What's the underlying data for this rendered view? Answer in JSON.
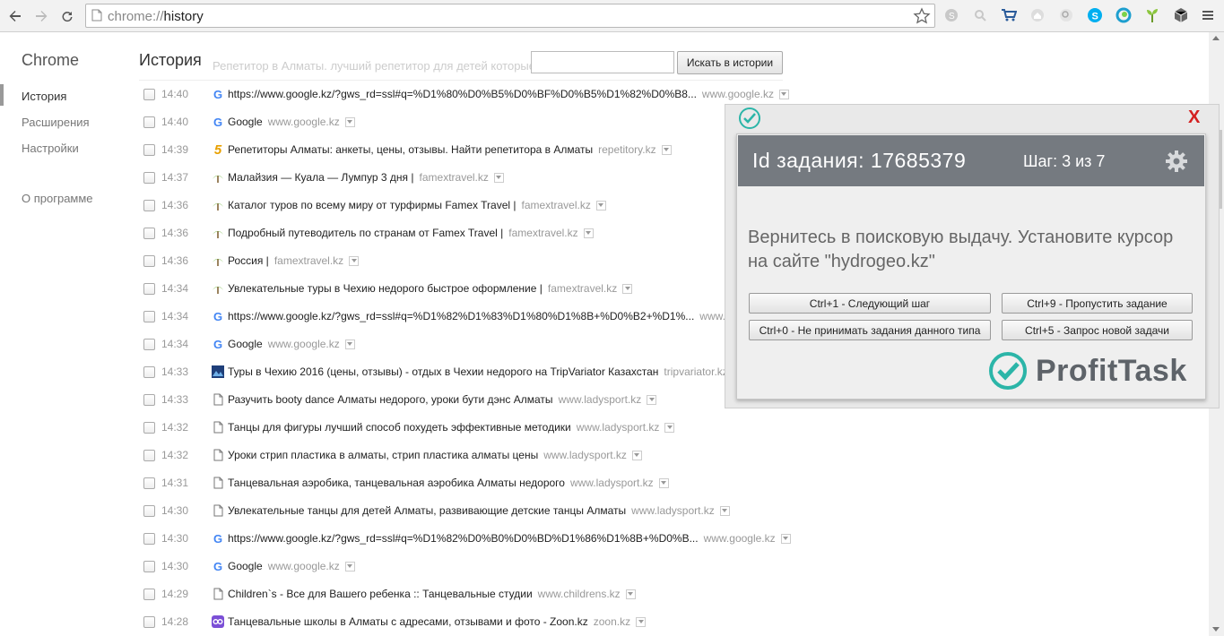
{
  "browser": {
    "url_scheme": "chrome://",
    "url_path": "history"
  },
  "sidebar": {
    "title": "Chrome",
    "items": [
      {
        "label": "История"
      },
      {
        "label": "Расширения"
      },
      {
        "label": "Настройки"
      },
      {
        "label": "О программе"
      }
    ]
  },
  "main": {
    "title": "История",
    "ghost_row": "Репетитор в Алматы. лучший репетитор для детей которые в",
    "search_placeholder": "",
    "search_button": "Искать в истории"
  },
  "history": [
    {
      "time": "14:40",
      "icon": "google-icon",
      "title": "https://www.google.kz/?gws_rd=ssl#q=%D1%80%D0%B5%D0%BF%D0%B5%D1%82%D0%B8...",
      "domain": "www.google.kz"
    },
    {
      "time": "14:40",
      "icon": "google-icon",
      "title": "Google",
      "domain": "www.google.kz"
    },
    {
      "time": "14:39",
      "icon": "five-icon",
      "title": "Репетиторы Алматы: анкеты, цены, отзывы. Найти репетитора в Алматы",
      "domain": "repetitory.kz"
    },
    {
      "time": "14:37",
      "icon": "palm-icon",
      "title": "Малайзия — Куала — Лумпур 3 дня |",
      "domain": "famextravel.kz"
    },
    {
      "time": "14:36",
      "icon": "palm-icon",
      "title": "Каталог туров по всему миру от турфирмы Famex Travel |",
      "domain": "famextravel.kz"
    },
    {
      "time": "14:36",
      "icon": "palm-icon",
      "title": "Подробный путеводитель по странам от Famex Travel |",
      "domain": "famextravel.kz"
    },
    {
      "time": "14:36",
      "icon": "palm-icon",
      "title": "Россия |",
      "domain": "famextravel.kz"
    },
    {
      "time": "14:34",
      "icon": "palm-icon",
      "title": "Увлекательные туры в Чехию недорого быстрое оформление |",
      "domain": "famextravel.kz"
    },
    {
      "time": "14:34",
      "icon": "google-icon",
      "title": "https://www.google.kz/?gws_rd=ssl#q=%D1%82%D1%83%D1%80%D1%8B+%D0%B2+%D1%...",
      "domain": "www.google.kz"
    },
    {
      "time": "14:34",
      "icon": "google-icon",
      "title": "Google",
      "domain": "www.google.kz"
    },
    {
      "time": "14:33",
      "icon": "tripvariator-icon",
      "title": "Туры в Чехию 2016 (цены, отзывы) - отдых в Чехии недорого на TripVariator Казахстан",
      "domain": "tripvariator.kz"
    },
    {
      "time": "14:33",
      "icon": "page-icon",
      "title": "Разучить booty dance Алматы недорого, уроки бути дэнс Алматы",
      "domain": "www.ladysport.kz"
    },
    {
      "time": "14:32",
      "icon": "page-icon",
      "title": "Танцы для фигуры лучший способ похудеть эффективные методики",
      "domain": "www.ladysport.kz"
    },
    {
      "time": "14:32",
      "icon": "page-icon",
      "title": "Уроки стрип пластика в алматы, стрип пластика алматы цены",
      "domain": "www.ladysport.kz"
    },
    {
      "time": "14:31",
      "icon": "page-icon",
      "title": "Танцевальная аэробика, танцевальная аэробика Алматы недорого",
      "domain": "www.ladysport.kz"
    },
    {
      "time": "14:30",
      "icon": "page-icon",
      "title": "Увлекательные танцы для детей Алматы, развивающие детские танцы Алматы",
      "domain": "www.ladysport.kz"
    },
    {
      "time": "14:30",
      "icon": "google-icon",
      "title": "https://www.google.kz/?gws_rd=ssl#q=%D1%82%D0%B0%D0%BD%D1%86%D1%8B+%D0%B...",
      "domain": "www.google.kz"
    },
    {
      "time": "14:30",
      "icon": "google-icon",
      "title": "Google",
      "domain": "www.google.kz"
    },
    {
      "time": "14:29",
      "icon": "page-icon",
      "title": "Children`s - Все для Вашего ребенка :: Танцевальные студии",
      "domain": "www.childrens.kz"
    },
    {
      "time": "14:28",
      "icon": "zoon-icon",
      "title": "Танцевальные школы в Алматы с адресами, отзывами и фото - Zoon.kz",
      "domain": "zoon.kz"
    }
  ],
  "profittask": {
    "task_id": "Id задания: 17685379",
    "step": "Шаг: 3 из 7",
    "instruction": "Вернитесь в поисковую выдачу. Установите курсор на сайте \"hydrogeo.kz\"",
    "buttons": {
      "next": "Ctrl+1 - Следующий шаг",
      "skip": "Ctrl+9 - Пропустить задание",
      "reject_type": "Ctrl+0 - Не принимать задания данного типа",
      "new_task": "Ctrl+5 - Запрос новой задачи"
    },
    "logo_text": "ProfitTask",
    "close_label": "X",
    "header_color": "#757a80",
    "brand_color": "#2bb5a8"
  }
}
